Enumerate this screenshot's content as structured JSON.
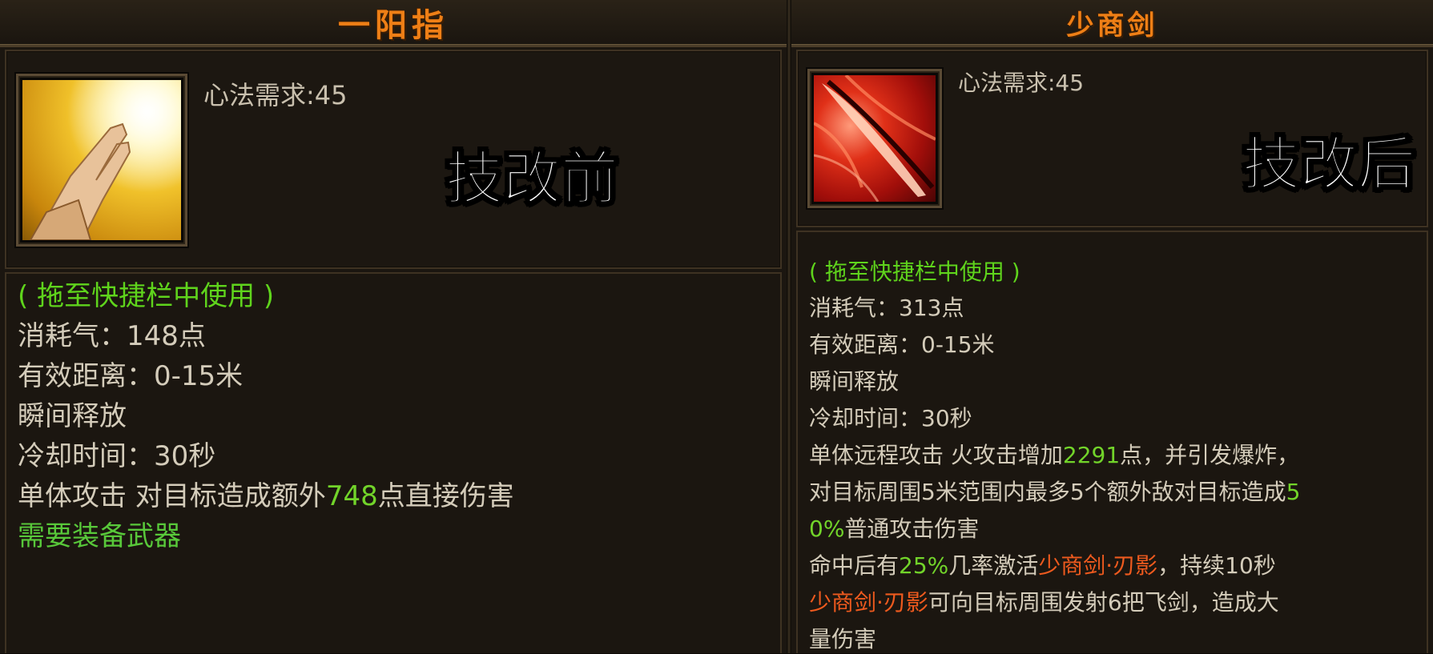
{
  "before": {
    "title": "一阳指",
    "requirement": "心法需求:45",
    "stamp": "技改前",
    "hint": "( 拖至快捷栏中使用 )",
    "cost": "消耗气：148点",
    "range": "有效距离：0-15米",
    "cast": "瞬间释放",
    "cooldown": "冷却时间：30秒",
    "effect_prefix": "单体攻击 对目标造成额外",
    "effect_value": "748",
    "effect_suffix": "点直接伤害",
    "weapon_req": "需要装备武器",
    "icon": "finger-point-icon"
  },
  "after": {
    "title": "少商剑",
    "requirement": "心法需求:45",
    "stamp": "技改后",
    "hint": "( 拖至快捷栏中使用 )",
    "cost": "消耗气：313点",
    "range": "有效距离：0-15米",
    "cast": "瞬间释放",
    "cooldown": "冷却时间：30秒",
    "line1_prefix": "单体远程攻击 火攻击增加",
    "line1_value": "2291",
    "line1_suffix": "点，并引发爆炸，",
    "line2_prefix": "对目标周围5米范围内最多5个额外敌对目标造成",
    "line2_value": "5",
    "line3_value": "0%",
    "line3_suffix": "普通攻击伤害",
    "line4_prefix": "命中后有",
    "line4_value": "25%",
    "line4_mid": "几率激活",
    "line4_skill": "少商剑·刃影",
    "line4_suffix": "，持续10秒",
    "line5_skill": "少商剑·刃影",
    "line5_suffix": "可向目标周围发射6把飞剑，造成大",
    "line6": "量伤害",
    "icon": "sword-slash-icon"
  },
  "colors": {
    "title": "#ee7f16",
    "hint_green": "#5fd41c",
    "value_green": "#72d42a",
    "skill_orange": "#ee5a1e",
    "text": "#d4ccba"
  }
}
